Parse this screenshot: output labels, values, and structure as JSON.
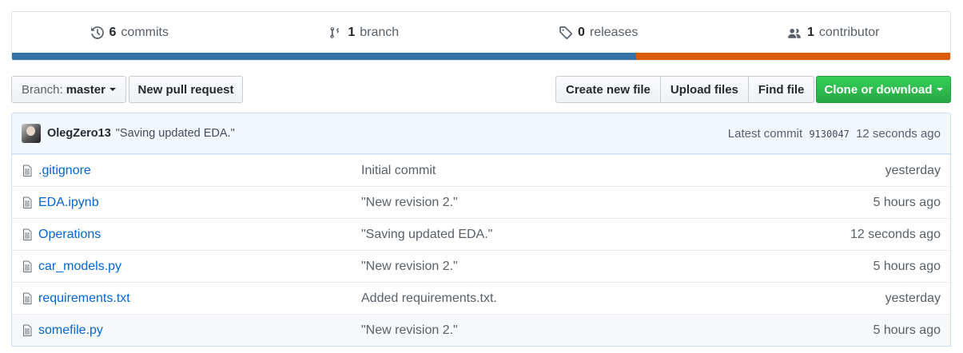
{
  "summary": {
    "commits": {
      "count": "6",
      "label": "commits",
      "icon": "history-icon"
    },
    "branch": {
      "count": "1",
      "label": "branch",
      "icon": "git-branch-icon"
    },
    "releases": {
      "count": "0",
      "label": "releases",
      "icon": "tag-icon"
    },
    "contributors": {
      "count": "1",
      "label": "contributor",
      "icon": "people-icon"
    },
    "language_bar": [
      {
        "color": "#3572A5",
        "fraction": 0.665
      },
      {
        "color": "#DA5B0B",
        "fraction": 0.335
      }
    ]
  },
  "toolbar": {
    "branch_prefix": "Branch:",
    "branch_name": "master",
    "new_pr": "New pull request",
    "create_file": "Create new file",
    "upload_files": "Upload files",
    "find_file": "Find file",
    "clone": "Clone or download"
  },
  "latest_commit": {
    "author": "OlegZero13",
    "message": "\"Saving updated EDA.\"",
    "prefix": "Latest commit",
    "sha": "9130047",
    "age": "12 seconds ago"
  },
  "files": [
    {
      "name": ".gitignore",
      "message": "Initial commit",
      "age": "yesterday"
    },
    {
      "name": "EDA.ipynb",
      "message": "\"New revision 2.\"",
      "age": "5 hours ago"
    },
    {
      "name": "Operations",
      "message": "\"Saving updated EDA.\"",
      "age": "12 seconds ago"
    },
    {
      "name": "car_models.py",
      "message": "\"New revision 2.\"",
      "age": "5 hours ago"
    },
    {
      "name": "requirements.txt",
      "message": "Added requirements.txt.",
      "age": "yesterday"
    },
    {
      "name": "somefile.py",
      "message": "\"New revision 2.\"",
      "age": "5 hours ago",
      "highlighted": true
    }
  ]
}
